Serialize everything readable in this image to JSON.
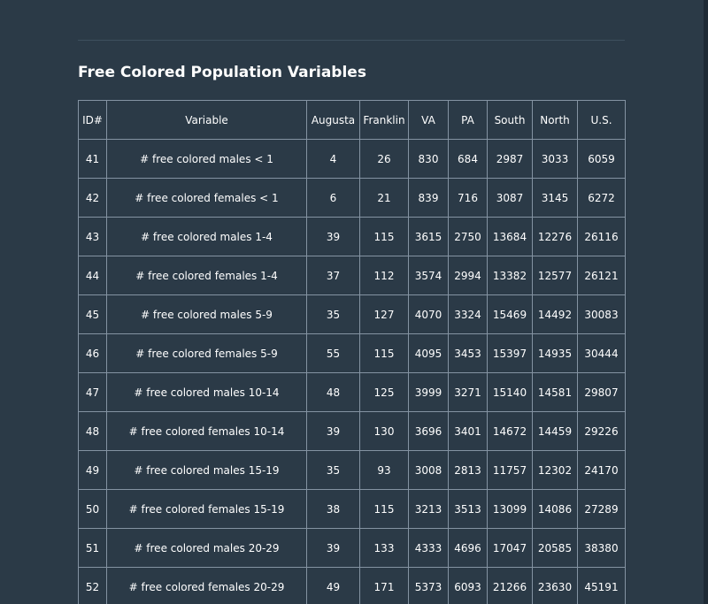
{
  "section": {
    "title": "Free Colored Population Variables"
  },
  "table": {
    "headers": [
      "ID#",
      "Variable",
      "Augusta",
      "Franklin",
      "VA",
      "PA",
      "South",
      "North",
      "U.S."
    ],
    "rows": [
      [
        "41",
        "# free colored males < 1",
        "4",
        "26",
        "830",
        "684",
        "2987",
        "3033",
        "6059"
      ],
      [
        "42",
        "# free colored females < 1",
        "6",
        "21",
        "839",
        "716",
        "3087",
        "3145",
        "6272"
      ],
      [
        "43",
        "# free colored males 1-4",
        "39",
        "115",
        "3615",
        "2750",
        "13684",
        "12276",
        "26116"
      ],
      [
        "44",
        "# free colored females 1-4",
        "37",
        "112",
        "3574",
        "2994",
        "13382",
        "12577",
        "26121"
      ],
      [
        "45",
        "# free colored males 5-9",
        "35",
        "127",
        "4070",
        "3324",
        "15469",
        "14492",
        "30083"
      ],
      [
        "46",
        "# free colored females 5-9",
        "55",
        "115",
        "4095",
        "3453",
        "15397",
        "14935",
        "30444"
      ],
      [
        "47",
        "# free colored males 10-14",
        "48",
        "125",
        "3999",
        "3271",
        "15140",
        "14581",
        "29807"
      ],
      [
        "48",
        "# free colored females 10-14",
        "39",
        "130",
        "3696",
        "3401",
        "14672",
        "14459",
        "29226"
      ],
      [
        "49",
        "# free colored males 15-19",
        "35",
        "93",
        "3008",
        "2813",
        "11757",
        "12302",
        "24170"
      ],
      [
        "50",
        "# free colored females 15-19",
        "38",
        "115",
        "3213",
        "3513",
        "13099",
        "14086",
        "27289"
      ],
      [
        "51",
        "# free colored males 20-29",
        "39",
        "133",
        "4333",
        "4696",
        "17047",
        "20585",
        "38380"
      ],
      [
        "52",
        "# free colored females 20-29",
        "49",
        "171",
        "5373",
        "6093",
        "21266",
        "23630",
        "45191"
      ]
    ]
  }
}
